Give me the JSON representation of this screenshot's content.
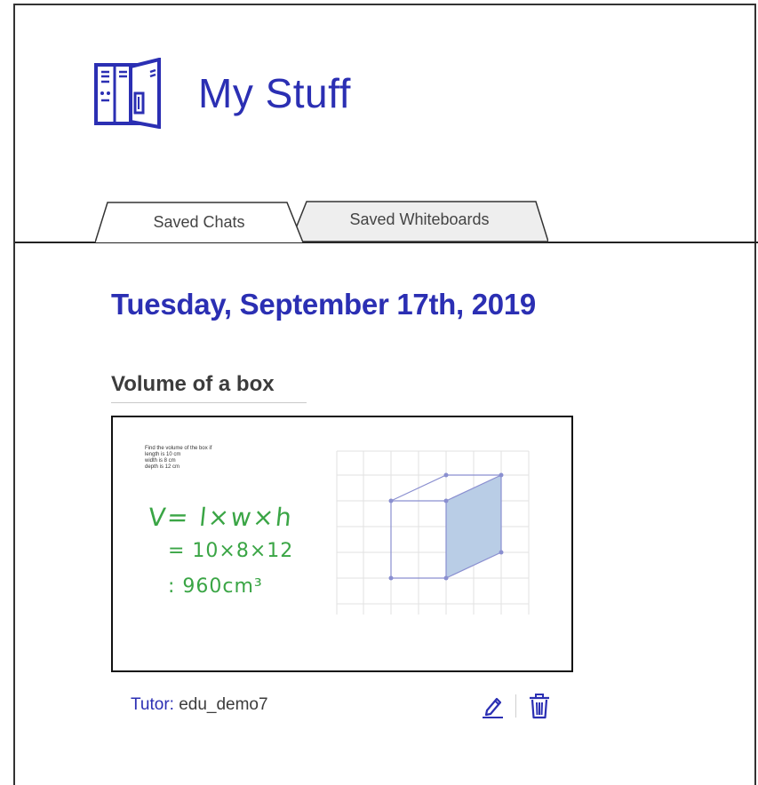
{
  "header": {
    "title": "My Stuff",
    "icon": "locker-icon"
  },
  "tabs": [
    {
      "label": "Saved Chats",
      "active": true
    },
    {
      "label": "Saved Whiteboards",
      "active": false
    }
  ],
  "date_heading": "Tuesday, September 17th, 2019",
  "item": {
    "title": "Volume of a box",
    "thumbnail": {
      "problem_lines": [
        "Find the volume of the box if",
        "length is 10 cm",
        "width is 8 cm",
        "depth is 12 cm"
      ],
      "handwriting": [
        "V= l×w×h",
        "= 10×8×12",
        ": 960cm³"
      ]
    },
    "tutor_label": "Tutor:",
    "tutor_name": "edu_demo7",
    "edit_icon": "pencil-icon",
    "delete_icon": "trash-icon"
  },
  "colors": {
    "brand": "#2b2fb3",
    "handwriting": "#3aa545",
    "cube_fill": "#b9cde6",
    "cube_stroke": "#8a8fd0"
  }
}
